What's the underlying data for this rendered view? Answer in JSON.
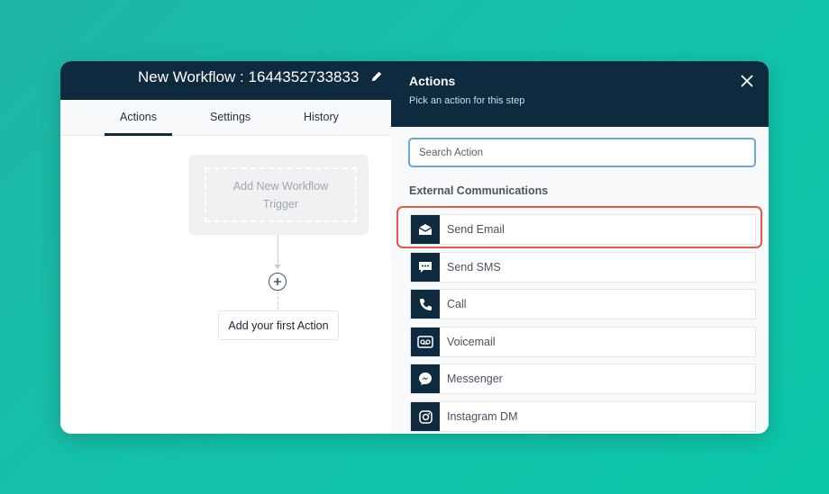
{
  "workflow": {
    "title": "New Workflow : 1644352733833",
    "edit_icon": "pencil-icon",
    "tabs": [
      "Actions",
      "Settings",
      "History"
    ],
    "active_tab": "Actions",
    "trigger_placeholder": "Add New Workflow Trigger",
    "add_first_action": "Add your first Action",
    "add_icon": "plus-circle-icon"
  },
  "actions_panel": {
    "title": "Actions",
    "subtitle": "Pick an action for this step",
    "close_icon": "close-icon",
    "search_placeholder": "Search Action",
    "section_title": "External Communications",
    "items": [
      {
        "label": "Send Email",
        "icon": "envelope-open-icon"
      },
      {
        "label": "Send SMS",
        "icon": "chat-bubble-icon"
      },
      {
        "label": "Call",
        "icon": "phone-icon"
      },
      {
        "label": "Voicemail",
        "icon": "voicemail-icon"
      },
      {
        "label": "Messenger",
        "icon": "messenger-icon"
      },
      {
        "label": "Instagram DM",
        "icon": "instagram-icon"
      }
    ],
    "highlighted_item": "Send Email"
  },
  "colors": {
    "header": "#0e2a3e",
    "highlight": "#e05a46",
    "search_border": "#6ea6d8",
    "background": "#13c2a9"
  }
}
